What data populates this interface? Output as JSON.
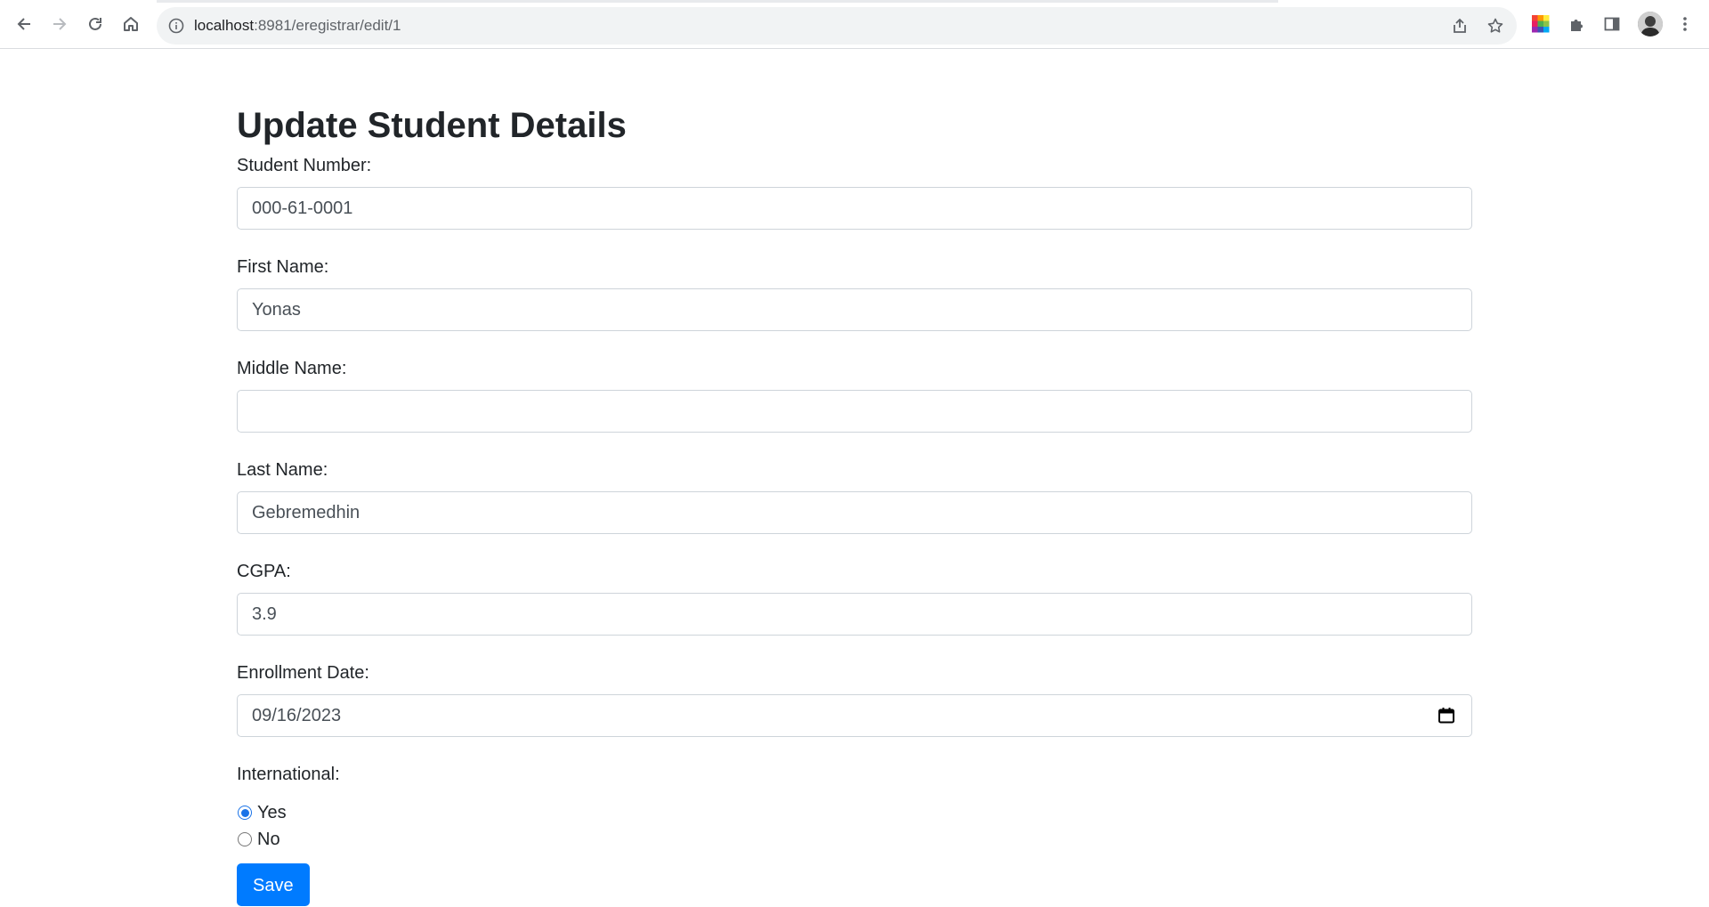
{
  "browser": {
    "url_host": "localhost",
    "url_rest": ":8981/eregistrar/edit/1",
    "icons": {
      "back": "back-arrow-icon",
      "forward": "forward-arrow-icon",
      "reload": "reload-icon",
      "home": "home-icon",
      "site_info": "info-icon",
      "share": "share-icon",
      "bookmark": "star-icon",
      "extension_color": "color-picker-extension-icon",
      "extensions": "puzzle-icon",
      "side_panel": "side-panel-icon",
      "profile": "avatar",
      "menu": "kebab-menu-icon"
    }
  },
  "page": {
    "title": "Update Student Details"
  },
  "form": {
    "student_number": {
      "label": "Student Number:",
      "value": "000-61-0001"
    },
    "first_name": {
      "label": "First Name:",
      "value": "Yonas"
    },
    "middle_name": {
      "label": "Middle Name:",
      "value": ""
    },
    "last_name": {
      "label": "Last Name:",
      "value": "Gebremedhin"
    },
    "cgpa": {
      "label": "CGPA:",
      "value": "3.9"
    },
    "enrollment_date": {
      "label": "Enrollment Date:",
      "value": "09/16/2023"
    },
    "international": {
      "label": "International:",
      "options": [
        {
          "label": "Yes",
          "checked": true
        },
        {
          "label": "No",
          "checked": false
        }
      ]
    },
    "save_label": "Save"
  },
  "colors": {
    "primary": "#007bff",
    "radio_accent": "#1a73e8"
  }
}
